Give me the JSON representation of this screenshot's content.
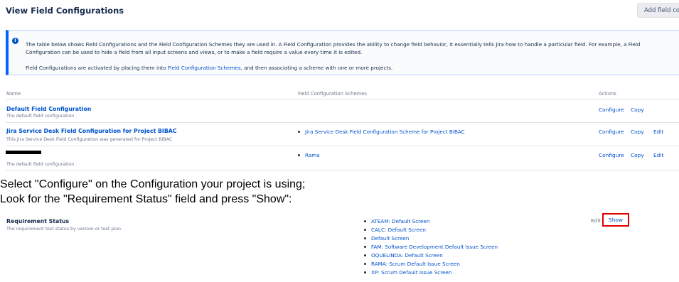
{
  "header": {
    "title": "View Field Configurations",
    "add_button_label": "Add field configuration"
  },
  "info": {
    "line1": "The table below shows Field Configurations and the Field Configuration Schemes they are used in. A Field Configuration provides the ability to change field behavior, it essentially tells Jira how to handle a particular field. For example, a Field",
    "line2": "Configuration can be used to hide a field from all input screens and views, or to make a field require a value every time it is edited.",
    "line3_pre": "Field Configurations are activated by placing them into ",
    "line3_link": "Field Configuration Schemes",
    "line3_post": ", and then associating a scheme with one or more projects."
  },
  "table": {
    "columns": [
      "Name",
      "Field Configuration Schemes",
      "Actions"
    ],
    "rows": [
      {
        "name": "Default Field Configuration",
        "description": "The default field configuration",
        "scheme": "",
        "actions": [
          "Configure",
          "Copy"
        ]
      },
      {
        "name": "Jira Service Desk Field Configuration for Project BIBAC",
        "description": "This Jira Service Desk Field Configuration was generated for Project BIBAC",
        "scheme": "Jira Service Desk Field Configuration Scheme for Project BIBAC",
        "actions": [
          "Configure",
          "Copy",
          "Edit"
        ]
      },
      {
        "name": "",
        "description": "The default field configuration",
        "scheme": "Rama",
        "actions": [
          "Configure",
          "Copy",
          "Edit"
        ]
      }
    ]
  },
  "instructions": {
    "line1": "Select \"Configure\" on the Configuration your project is using;",
    "line2": "Look for the \"Requirement Status\" field and press \"Show\":"
  },
  "field": {
    "name": "Requirement Status",
    "description": "The requirement test status by version or test plan",
    "screens": [
      "ATEAM: Default Screen",
      "CALC: Default Screen",
      "Default Screen",
      "FAM: Software Development Default Issue Screen",
      "OQUELINDA: Default Screen",
      "RAMA: Scrum Default Issue Screen",
      "XP: Scrum Default Issue Screen"
    ],
    "edit_label": "Edit",
    "show_label": "Show"
  },
  "colors": {
    "link": "#0052cc",
    "highlight": "#e00000",
    "info_border": "#0065ff"
  }
}
